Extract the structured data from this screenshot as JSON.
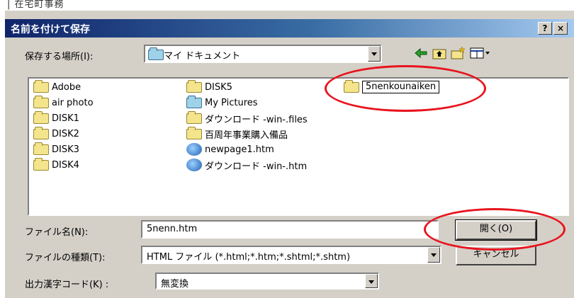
{
  "top_strip_text": "| 在宅町事務",
  "dialog": {
    "title": "名前を付けて保存",
    "help_button": "?",
    "close_button": "×"
  },
  "save_in": {
    "label": "保存する場所(I):",
    "value": "マイ ドキュメント"
  },
  "toolbar": {
    "icons": [
      "back-arrow-icon",
      "up-folder-icon",
      "new-folder-icon",
      "view-menu-icon"
    ]
  },
  "files": {
    "col1": [
      "Adobe",
      "air photo",
      "DISK1",
      "DISK2",
      "DISK3",
      "DISK4"
    ],
    "col2": [
      {
        "name": "DISK5",
        "type": "folder"
      },
      {
        "name": "My Pictures",
        "type": "special"
      },
      {
        "name": "ダウンロード -win-.files",
        "type": "folder"
      },
      {
        "name": "百周年事業購入備品",
        "type": "folder"
      },
      {
        "name": "newpage1.htm",
        "type": "htm"
      },
      {
        "name": "ダウンロード -win-.htm",
        "type": "htm"
      }
    ],
    "new_folder": "5nenkounaiken"
  },
  "filename": {
    "label": "ファイル名(N):",
    "value": "5nenn.htm"
  },
  "filetype": {
    "label": "ファイルの種類(T):",
    "value": "HTML ファイル (*.html;*.htm;*.shtml;*.shtm)"
  },
  "encoding": {
    "label": "出力漢字コード(K) :",
    "value": "無変換"
  },
  "buttons": {
    "open": "開く(O)",
    "cancel": "キャンセル"
  },
  "annotation_color": "#e8141e"
}
